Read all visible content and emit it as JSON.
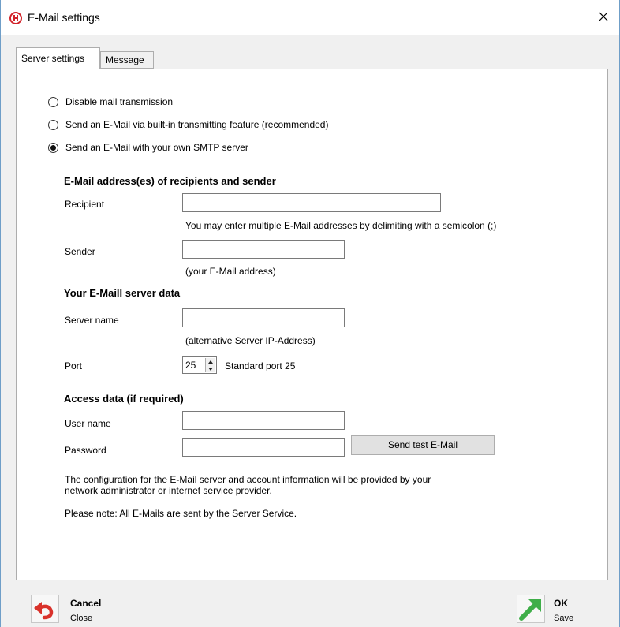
{
  "window": {
    "title": "E-Mail settings",
    "close_glyph": "✕"
  },
  "tabs": [
    {
      "label": "Server settings",
      "active": true
    },
    {
      "label": "Message",
      "active": false
    }
  ],
  "transmission": {
    "options": [
      {
        "label": "Disable mail transmission",
        "selected": false
      },
      {
        "label": "Send an E-Mail via built-in transmitting feature (recommended)",
        "selected": false
      },
      {
        "label": "Send an E-Mail with your own SMTP server",
        "selected": true
      }
    ]
  },
  "addresses": {
    "heading": "E-Mail address(es) of recipients and sender",
    "recipient_label": "Recipient",
    "recipient_value": "",
    "recipient_hint": "You may enter multiple E-Mail addresses by delimiting with a semicolon (;)",
    "sender_label": "Sender",
    "sender_value": "",
    "sender_hint": "(your E-Mail address)"
  },
  "server": {
    "heading": "Your E-Maill server data",
    "name_label": "Server name",
    "name_value": "",
    "name_hint": "(alternative Server IP-Address)",
    "port_label": "Port",
    "port_value": "25",
    "port_hint": "Standard port 25"
  },
  "access": {
    "heading": "Access data (if required)",
    "user_label": "User name",
    "user_value": "",
    "password_label": "Password",
    "password_value": "",
    "test_button": "Send test E-Mail"
  },
  "info": {
    "line1": "The configuration for the E-Mail server and account information will be provided by your",
    "line2": "network administrator or internet service provider.",
    "note": "Please note: All E-Mails are sent by the Server Service."
  },
  "footer": {
    "cancel_label": "Cancel",
    "cancel_sub": "Close",
    "ok_label": "OK",
    "ok_sub": "Save"
  },
  "colors": {
    "accent_border": "#6f9ec8",
    "logo_red": "#d2232a",
    "cancel_red": "#d9322b",
    "ok_green": "#3fae49"
  },
  "icons": {
    "app": "app-logo-icon",
    "close": "close-icon",
    "cancel": "undo-arrow-icon",
    "ok": "diagonal-arrow-icon"
  }
}
